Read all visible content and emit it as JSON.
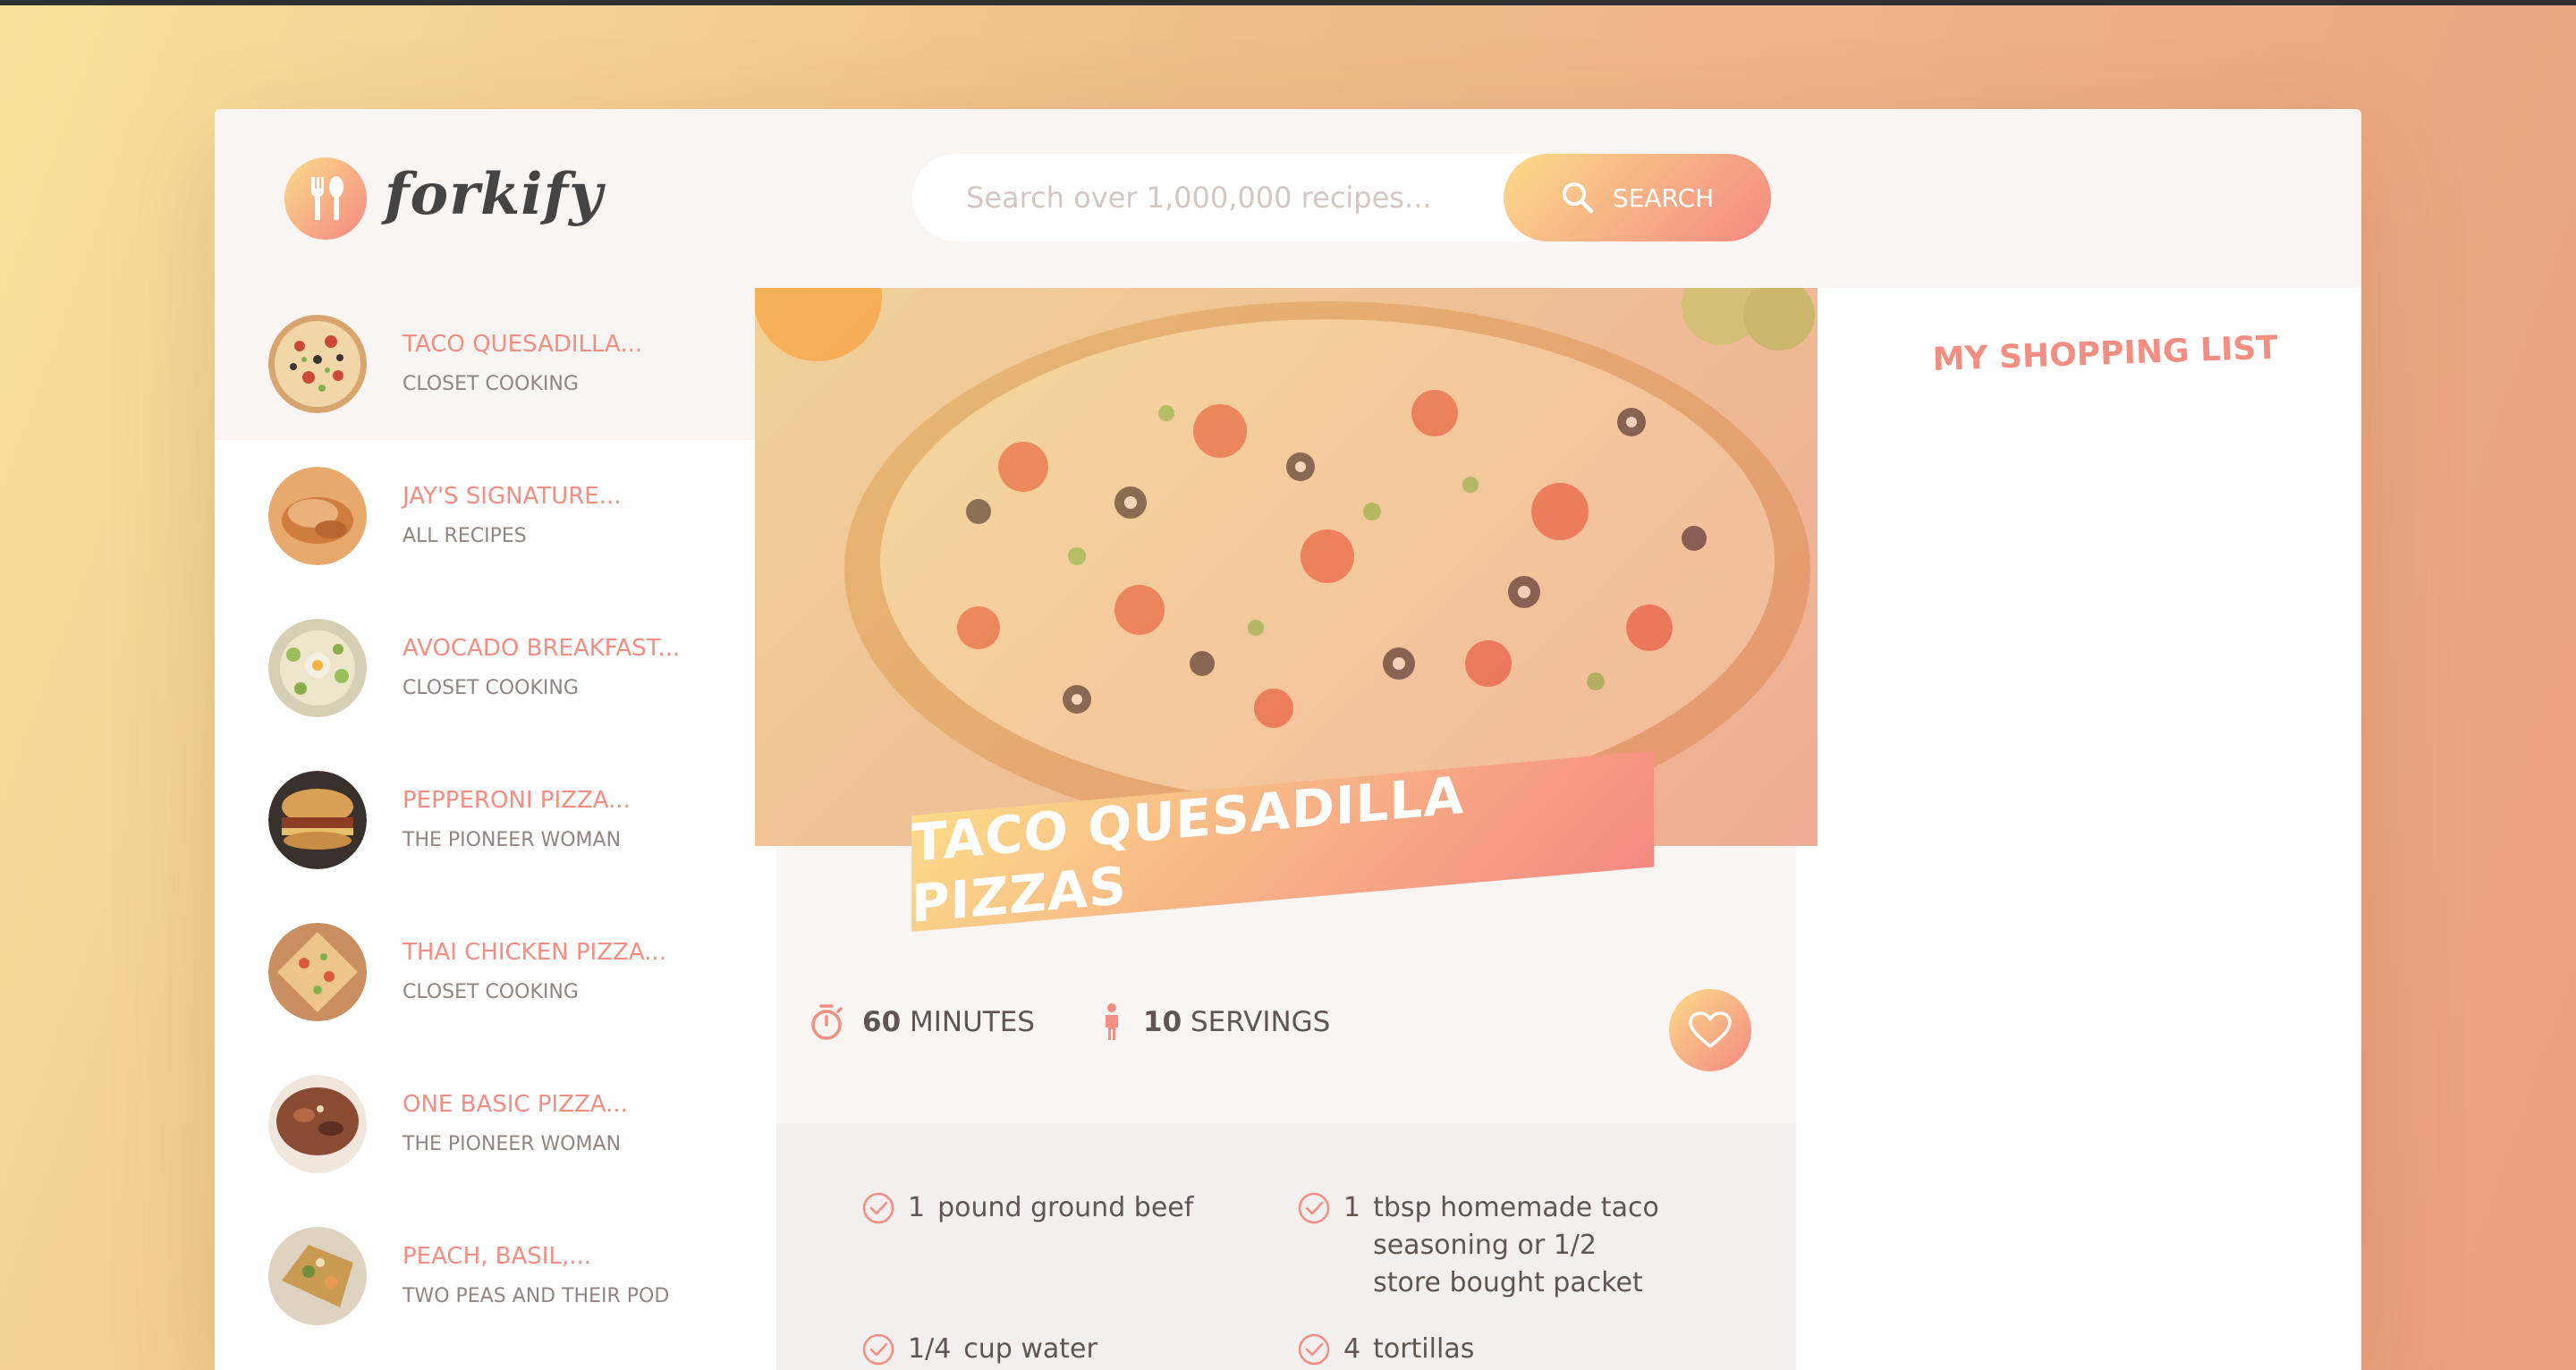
{
  "header": {
    "logo_text": "forkify",
    "search_placeholder": "Search over 1,000,000 recipes...",
    "search_button_label": "SEARCH"
  },
  "results": [
    {
      "title": "TACO QUESADILLA...",
      "publisher": "CLOSET COOKING",
      "active": true
    },
    {
      "title": "JAY'S SIGNATURE...",
      "publisher": "ALL RECIPES",
      "active": false
    },
    {
      "title": "AVOCADO BREAKFAST...",
      "publisher": "CLOSET COOKING",
      "active": false
    },
    {
      "title": "PEPPERONI PIZZA...",
      "publisher": "THE PIONEER WOMAN",
      "active": false
    },
    {
      "title": "THAI CHICKEN PIZZA...",
      "publisher": "CLOSET COOKING",
      "active": false
    },
    {
      "title": "ONE BASIC PIZZA...",
      "publisher": "THE PIONEER WOMAN",
      "active": false
    },
    {
      "title": "PEACH, BASIL,...",
      "publisher": "TWO PEAS AND THEIR POD",
      "active": false
    }
  ],
  "recipe": {
    "title": "TACO QUESADILLA PIZZAS",
    "time_value": "60",
    "time_unit": "MINUTES",
    "servings_value": "10",
    "servings_unit": "SERVINGS",
    "ingredients": [
      {
        "count": "1",
        "text": "pound ground beef"
      },
      {
        "count": "1",
        "text": "tbsp homemade taco seasoning or 1/2 store bought packet"
      },
      {
        "count": "1/4",
        "text": "cup water"
      },
      {
        "count": "4",
        "text": "tortillas"
      }
    ]
  },
  "shopping": {
    "title": "MY SHOPPING LIST"
  },
  "colors": {
    "accent_start": "#fbdb89",
    "accent_end": "#f48982",
    "text": "#615551",
    "light_bg": "#f9f5f3"
  }
}
